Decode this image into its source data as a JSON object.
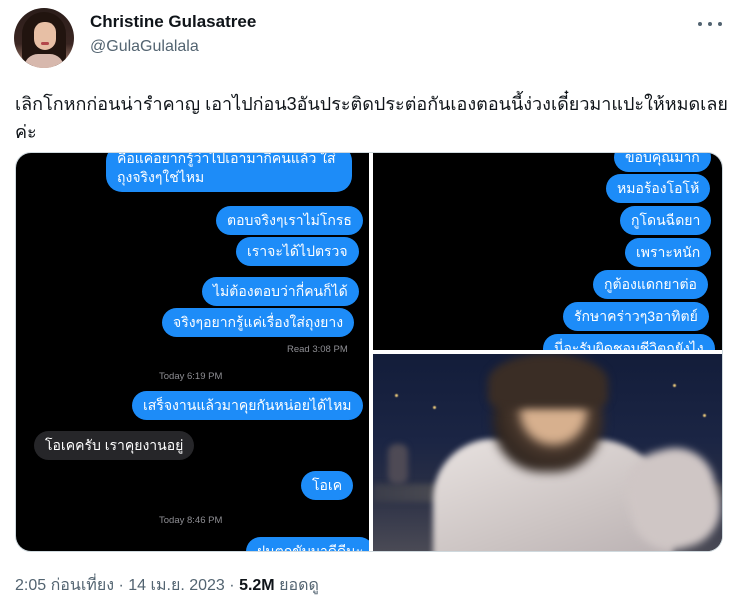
{
  "author": {
    "name": "Christine Gulasatree",
    "handle": "@GulaGulalala"
  },
  "tweet": {
    "text": "เลิกโกหกก่อนน่ารำคาญ เอาไปก่อน3อันประติดประต่อกันเองตอนนี้ง่วงเดี๋ยวมาแปะให้หมดเลยค่ะ"
  },
  "media": {
    "chat_left": {
      "sent_top": "คือแค่อยากรู้ว่าไปเอามากี่คนแล้ว ใส่ถุงจริงๆใช่ไหม",
      "sent_1": "ตอบจริงๆเราไม่โกรธ",
      "sent_2": "เราจะได้ไปตรวจ",
      "sent_3": "ไม่ต้องตอบว่ากี่คนก็ได้",
      "sent_4": "จริงๆอยากรู้แค่เรื่องใส่ถุงยาง",
      "read": "Read 3:08 PM",
      "stamp_1": "Today 6:19 PM",
      "sent_5": "เสร็จงานแล้วมาคุยกันหน่อยได้ไหม",
      "recv_1": "โอเคครับ เราคุยงานอยู่",
      "sent_6": "โอเค",
      "stamp_2": "Today 8:46 PM",
      "sent_cut": "ฝนตกขับมาดีดีนะ"
    },
    "chat_right": {
      "sent_top": "ขอบคุณมาก",
      "sent_1": "หมอร้องโอโห้",
      "sent_2": "กูโดนฉีดยา",
      "sent_3": "เพราะหนัก",
      "sent_4": "กูต้องแดกยาต่อ",
      "sent_5": "รักษาคร่าวๆ3อาทิตย์",
      "sent_cut": "นี่จะรับผิดชอบชีวิตกูยังไง"
    }
  },
  "footer": {
    "time": "2:05 ก่อนเที่ยง",
    "sep1": "·",
    "date": "14 เม.ย. 2023",
    "sep2": "·",
    "views_count": "5.2M",
    "views_label": "ยอดดู"
  },
  "colors": {
    "imessage_blue": "#1d8cf8",
    "received_gray": "#262629",
    "muted_text": "#536471"
  },
  "icons": [
    "more-icon"
  ]
}
